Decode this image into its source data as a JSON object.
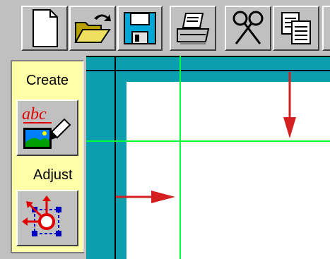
{
  "toolbar": {
    "buttons": [
      {
        "name": "new-document",
        "icon": "new-document-icon"
      },
      {
        "name": "open-folder",
        "icon": "open-folder-icon"
      },
      {
        "name": "save",
        "icon": "floppy-disk-icon"
      },
      {
        "name": "print",
        "icon": "printer-icon"
      },
      {
        "name": "cut",
        "icon": "scissors-icon"
      },
      {
        "name": "copy",
        "icon": "copy-icon"
      }
    ]
  },
  "sidebar": {
    "create_label": "Create",
    "create_icon": "text-tool-icon",
    "create_icon_text": "abc",
    "adjust_label": "Adjust",
    "adjust_icon": "move-handles-icon"
  },
  "colors": {
    "workspace": "#0a9eaf",
    "guide": "#00ff3c",
    "arrow": "#d42020",
    "panel": "#ffffa8"
  }
}
